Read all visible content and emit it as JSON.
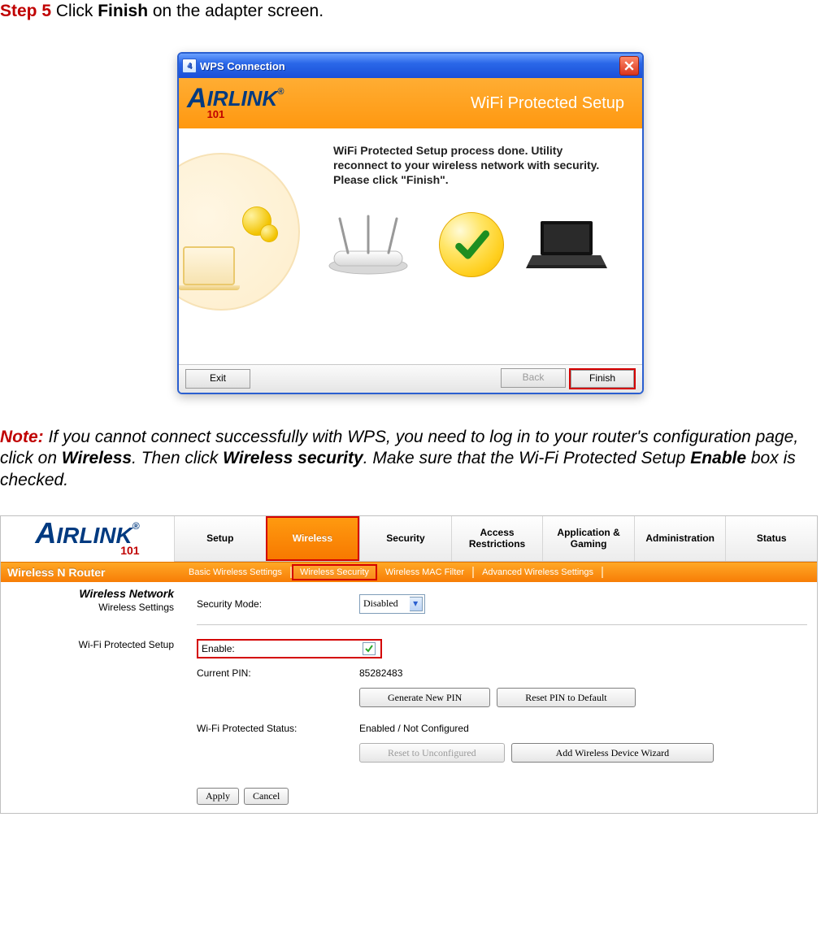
{
  "doc": {
    "step_label": "Step 5",
    "step_rest": " Click ",
    "step_bold": "Finish",
    "step_after": " on the adapter screen.",
    "note_label": "Note:",
    "note_line1": " If you cannot connect successfully with WPS, you need to log in to your router's configuration page, click on ",
    "note_link1_bold": "Wireless",
    "note_mid1": ".  Then click ",
    "note_link2_bold": "Wireless security",
    "note_mid2": ".  Make sure that the Wi-Fi Protected Setup ",
    "note_enable_bold": "Enable",
    "note_end": " box is checked."
  },
  "wps_dialog": {
    "title": "WPS Connection",
    "brand_main": "IRLINK",
    "brand_sub": "101",
    "brand_reg": "®",
    "header_text": "WiFi Protected Setup",
    "message": "WiFi Protected Setup process done. Utility reconnect to your wireless network with security. Please click \"Finish\".",
    "buttons": {
      "exit": "Exit",
      "back": "Back",
      "finish": "Finish"
    }
  },
  "router": {
    "brand_main": "IRLINK",
    "brand_sub": "101",
    "brand_reg": "®",
    "model_line": "Wireless N Router",
    "tabs": [
      "Setup",
      "Wireless",
      "Security",
      "Access Restrictions",
      "Application & Gaming",
      "Administration",
      "Status"
    ],
    "active_tab_index": 1,
    "subnav": [
      "Basic Wireless Settings",
      "Wireless Security",
      "Wireless MAC Filter",
      "Advanced Wireless Settings"
    ],
    "active_sub_index": 1,
    "aside": {
      "section_title": "Wireless Network",
      "settings_label": "Wireless Settings",
      "wps_label": "Wi-Fi Protected Setup"
    },
    "form": {
      "security_mode_label": "Security Mode:",
      "security_mode_value": "Disabled",
      "enable_label": "Enable:",
      "enable_checked": true,
      "pin_label": "Current PIN:",
      "pin_value": "85282483",
      "gen_pin_btn": "Generate New PIN",
      "reset_pin_btn": "Reset PIN to Default",
      "status_label": "Wi-Fi Protected Status:",
      "status_value": "Enabled / Not Configured",
      "reset_unconf_btn": "Reset to Unconfigured",
      "add_device_btn": "Add Wireless Device Wizard",
      "apply_btn": "Apply",
      "cancel_btn": "Cancel"
    }
  }
}
